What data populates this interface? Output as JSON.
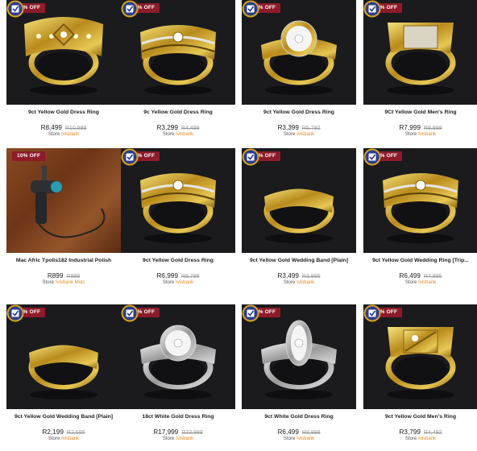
{
  "products": [
    {
      "badge": "23% OFF",
      "title": "9ct Yellow Gold Dress Ring",
      "price": "R8,499",
      "old_price": "R10,999",
      "store_label": "Store",
      "store_name": "Ivisbank",
      "seal": true,
      "ring": "wide-yellow"
    },
    {
      "badge": "27% OFF",
      "title": "9c Yellow Gold Dress Ring",
      "price": "R3,299",
      "old_price": "R4,499",
      "store_label": "Store",
      "store_name": "Ivisbank",
      "seal": true,
      "ring": "filigree-yellow"
    },
    {
      "badge": "41% OFF",
      "title": "9ct Yellow Gold Dress Ring",
      "price": "R3,399",
      "old_price": "R5,792",
      "store_label": "Store",
      "store_name": "Ivisbank",
      "seal": true,
      "ring": "cluster-yellow"
    },
    {
      "badge": "20% OFF",
      "title": "9Ct Yellow Gold Men's Ring",
      "price": "R7,999",
      "old_price": "R9,999",
      "store_label": "Store",
      "store_name": "Ivisbank",
      "seal": true,
      "ring": "signet-yellow"
    },
    {
      "badge": "10% OFF",
      "title": "Mac Afric Tpolis182 Industrial Polish",
      "price": "R899",
      "old_price": "R999",
      "store_label": "Store",
      "store_name": "Ivisbank Midc",
      "seal": false,
      "ring": "tool"
    },
    {
      "badge": "29% OFF",
      "title": "9ct Yellow Gold Dress Ring",
      "price": "R6,999",
      "old_price": "R9,799",
      "store_label": "Store",
      "store_name": "Ivisbank",
      "seal": true,
      "ring": "multiband-yellow"
    },
    {
      "badge": "12% OFF",
      "title": "9ct Yellow Gold Wedding Band [Plain]",
      "price": "R3,499",
      "old_price": "R3,995",
      "store_label": "Store",
      "store_name": "Ivisbank",
      "seal": true,
      "ring": "plain-yellow"
    },
    {
      "badge": "19% OFF",
      "title": "9ct Yellow Gold Wedding Ring [Trip...",
      "price": "R6,499",
      "old_price": "R7,995",
      "store_label": "Store",
      "store_name": "Ivisbank",
      "seal": true,
      "ring": "swirl-yellow"
    },
    {
      "badge": "18% OFF",
      "title": "9ct Yellow Gold Wedding Band [Plain]",
      "price": "R2,199",
      "old_price": "R2,695",
      "store_label": "Store",
      "store_name": "Ivisbank",
      "seal": true,
      "ring": "band-yellow"
    },
    {
      "badge": "25% OFF",
      "title": "18ct White Gold Dress Ring",
      "price": "R17,999",
      "old_price": "R23,999",
      "store_label": "Store",
      "store_name": "Ivisbank",
      "seal": true,
      "ring": "halo-white"
    },
    {
      "badge": "23% OFF",
      "title": "9ct White Gold Dress Ring",
      "price": "R6,499",
      "old_price": "R8,999",
      "store_label": "Store",
      "store_name": "Ivisbank",
      "seal": true,
      "ring": "marquise-white"
    },
    {
      "badge": "15% OFF",
      "title": "9ct Yellow Gold Men's Ring",
      "price": "R3,799",
      "old_price": "R4,492",
      "store_label": "Store",
      "store_name": "Ivisbank",
      "seal": true,
      "ring": "diagonal-yellow"
    }
  ],
  "colors": {
    "badge": "#8e1b2a",
    "store_link": "#e58a1f",
    "image_bg": "#1b1b1d"
  }
}
